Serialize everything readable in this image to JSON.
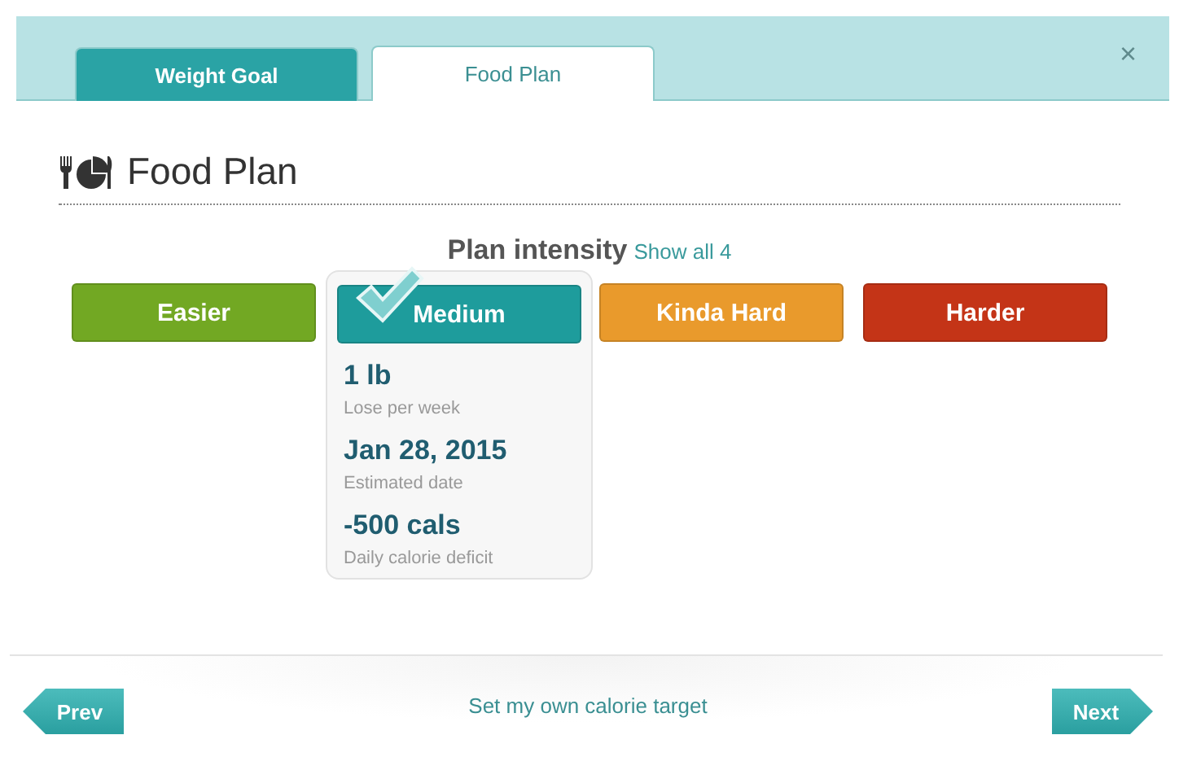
{
  "tabs": [
    {
      "label": "Weight Goal",
      "selected": false
    },
    {
      "label": "Food Plan",
      "selected": true
    }
  ],
  "close": "×",
  "heading": "Food Plan",
  "intensity": {
    "title": "Plan intensity",
    "link": "Show all 4"
  },
  "options": [
    {
      "label": "Easier",
      "color": "#72a823",
      "selected": false
    },
    {
      "label": "Medium",
      "color": "#1e9c9c",
      "selected": true,
      "details": [
        {
          "value": "1 lb",
          "caption": "Lose per week"
        },
        {
          "value": "Jan 28, 2015",
          "caption": "Estimated date"
        },
        {
          "value": "-500 cals",
          "caption": "Daily calorie deficit"
        }
      ]
    },
    {
      "label": "Kinda Hard",
      "color": "#e99a2c",
      "selected": false
    },
    {
      "label": "Harder",
      "color": "#c43417",
      "selected": false
    }
  ],
  "footer": {
    "prev": "Prev",
    "link": "Set my own calorie target",
    "next": "Next"
  }
}
